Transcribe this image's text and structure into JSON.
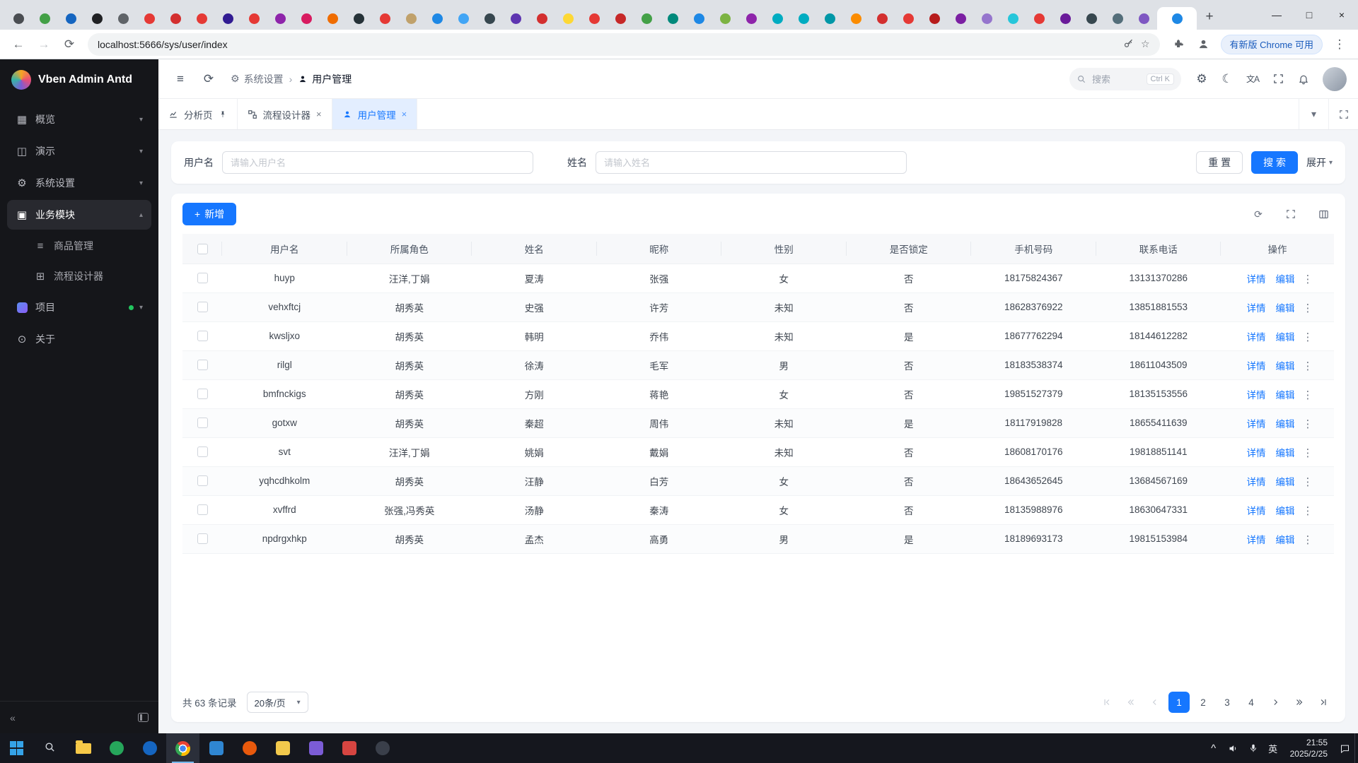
{
  "browser": {
    "url": "localhost:5666/sys/user/index",
    "update_badge": "有新版 Chrome 可用",
    "active_tab_favicon": "#1e88e5",
    "favicon_colors": [
      "#4a4d52",
      "#43a047",
      "#1565c0",
      "#202124",
      "#5f6368",
      "#e53935",
      "#d32f2f",
      "#e53935",
      "#311b92",
      "#e53935",
      "#8e24aa",
      "#d81b60",
      "#ef6c00",
      "#263238",
      "#e53935",
      "#c0a16b",
      "#1e88e5",
      "#42a5f5",
      "#37474f",
      "#5e35b1",
      "#d32f2f",
      "#fdd835",
      "#e53935",
      "#c62828",
      "#43a047",
      "#00897b",
      "#1e88e5",
      "#7cb342",
      "#8e24aa",
      "#00acc1",
      "#00acc1",
      "#0097a7",
      "#fb8c00",
      "#d32f2f",
      "#e53935",
      "#b71c1c",
      "#7b1fa2",
      "#9575cd",
      "#26c6da",
      "#e53935",
      "#6a1b9a",
      "#37474f",
      "#546e7a",
      "#7e57c2"
    ]
  },
  "app": {
    "logo_text": "Vben Admin Antd",
    "sidebar": {
      "items": [
        {
          "id": "overview",
          "label": "概览",
          "icon": "grid",
          "chevron": "down"
        },
        {
          "id": "demo",
          "label": "演示",
          "icon": "monitor",
          "chevron": "down"
        },
        {
          "id": "system-settings",
          "label": "系统设置",
          "icon": "gear",
          "chevron": "down"
        },
        {
          "id": "business-module",
          "label": "业务模块",
          "icon": "module",
          "chevron": "up",
          "active": true,
          "children": [
            {
              "id": "goods",
              "label": "商品管理",
              "icon": "list"
            },
            {
              "id": "flow-designer",
              "label": "流程设计器",
              "icon": "flow"
            }
          ]
        },
        {
          "id": "project",
          "label": "项目",
          "icon": "project",
          "chevron": "down",
          "dot": true
        },
        {
          "id": "about",
          "label": "关于",
          "icon": "info"
        }
      ]
    },
    "header": {
      "breadcrumb": [
        {
          "label": "系统设置",
          "icon": "gear"
        },
        {
          "label": "用户管理",
          "icon": "user"
        }
      ],
      "search_placeholder": "搜索",
      "search_kbd": "Ctrl K"
    },
    "tabbar": {
      "tabs": [
        {
          "label": "分析页",
          "icon": "chart",
          "pinned": true
        },
        {
          "label": "流程设计器",
          "icon": "flow",
          "closable": true
        },
        {
          "label": "用户管理",
          "icon": "user",
          "closable": true,
          "active": true
        }
      ]
    },
    "query": {
      "fields": [
        {
          "label": "用户名",
          "placeholder": "请输入用户名"
        },
        {
          "label": "姓名",
          "placeholder": "请输入姓名"
        }
      ],
      "reset_label": "重 置",
      "search_label": "搜 索",
      "expand_label": "展开"
    },
    "table": {
      "add_label": "新增",
      "columns": [
        "用户名",
        "所属角色",
        "姓名",
        "昵称",
        "性别",
        "是否锁定",
        "手机号码",
        "联系电话",
        "操作"
      ],
      "rows": [
        [
          "huyp",
          "汪洋,丁娟",
          "夏涛",
          "张强",
          "女",
          "否",
          "18175824367",
          "13131370286"
        ],
        [
          "vehxftcj",
          "胡秀英",
          "史强",
          "许芳",
          "未知",
          "否",
          "18628376922",
          "13851881553"
        ],
        [
          "kwsljxo",
          "胡秀英",
          "韩明",
          "乔伟",
          "未知",
          "是",
          "18677762294",
          "18144612282"
        ],
        [
          "rilgl",
          "胡秀英",
          "徐涛",
          "毛军",
          "男",
          "否",
          "18183538374",
          "18611043509"
        ],
        [
          "bmfnckigs",
          "胡秀英",
          "方刚",
          "蒋艳",
          "女",
          "否",
          "19851527379",
          "18135153556"
        ],
        [
          "gotxw",
          "胡秀英",
          "秦超",
          "周伟",
          "未知",
          "是",
          "18117919828",
          "18655411639"
        ],
        [
          "svt",
          "汪洋,丁娟",
          "姚娟",
          "戴娟",
          "未知",
          "否",
          "18608170176",
          "19818851141"
        ],
        [
          "yqhcdhkolm",
          "胡秀英",
          "汪静",
          "白芳",
          "女",
          "否",
          "18643652645",
          "13684567169"
        ],
        [
          "xvffrd",
          "张强,冯秀英",
          "汤静",
          "秦涛",
          "女",
          "否",
          "18135988976",
          "18630647331"
        ],
        [
          "npdrgxhkp",
          "胡秀英",
          "孟杰",
          "高勇",
          "男",
          "是",
          "18189693173",
          "19815153984"
        ]
      ],
      "row_actions": [
        "详情",
        "编辑"
      ]
    },
    "pagination": {
      "total_text": "共 63 条记录",
      "page_size": "20条/页",
      "pages": [
        "1",
        "2",
        "3",
        "4"
      ],
      "active_page": "1"
    }
  },
  "colors": {
    "primary": "#1677ff"
  },
  "taskbar": {
    "time": "21:55",
    "date": "2025/2/25",
    "lang": "英",
    "items": [
      {
        "name": "start",
        "type": "windows"
      },
      {
        "name": "search",
        "type": "magnifier"
      },
      {
        "name": "file-explorer",
        "type": "folder"
      },
      {
        "name": "wechat",
        "type": "round",
        "color": "#26a65b"
      },
      {
        "name": "edge",
        "type": "round",
        "color": "#1565c0"
      },
      {
        "name": "chrome",
        "type": "chrome",
        "active": true
      },
      {
        "name": "vscode",
        "type": "square",
        "color": "#2f86d2"
      },
      {
        "name": "firefox",
        "type": "round",
        "color": "#e8590c"
      },
      {
        "name": "sticky-notes",
        "type": "square",
        "color": "#f2c94c"
      },
      {
        "name": "app-purple",
        "type": "square",
        "color": "#7b5cd6"
      },
      {
        "name": "app-red",
        "type": "square",
        "color": "#d64541"
      },
      {
        "name": "app-dark",
        "type": "round",
        "color": "#3a3f4a"
      }
    ]
  }
}
